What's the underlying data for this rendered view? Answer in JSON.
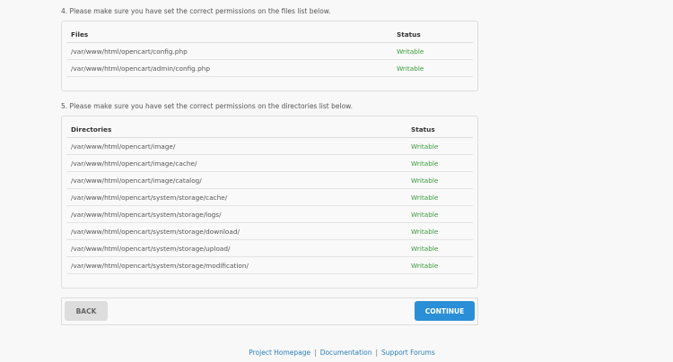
{
  "files_section": {
    "note": "4. Please make sure you have set the correct permissions on the files list below.",
    "headers": [
      "Files",
      "Status"
    ],
    "rows": [
      {
        "path": "/var/www/html/opencart/config.php",
        "status": "Writable"
      },
      {
        "path": "/var/www/html/opencart/admin/config.php",
        "status": "Writable"
      }
    ]
  },
  "dirs_section": {
    "note": "5. Please make sure you have set the correct permissions on the directories list below.",
    "headers": [
      "Directories",
      "Status"
    ],
    "rows": [
      {
        "path": "/var/www/html/opencart/image/",
        "status": "Writable"
      },
      {
        "path": "/var/www/html/opencart/image/cache/",
        "status": "Writable"
      },
      {
        "path": "/var/www/html/opencart/image/catalog/",
        "status": "Writable"
      },
      {
        "path": "/var/www/html/opencart/system/storage/cache/",
        "status": "Writable"
      },
      {
        "path": "/var/www/html/opencart/system/storage/logs/",
        "status": "Writable"
      },
      {
        "path": "/var/www/html/opencart/system/storage/download/",
        "status": "Writable"
      },
      {
        "path": "/var/www/html/opencart/system/storage/upload/",
        "status": "Writable"
      },
      {
        "path": "/var/www/html/opencart/system/storage/modification/",
        "status": "Writable"
      }
    ]
  },
  "buttons": {
    "back": "BACK",
    "continue": "CONTINUE"
  },
  "footer": {
    "links": [
      "Project Homepage",
      "Documentation",
      "Support Forums"
    ],
    "separator": "|"
  }
}
